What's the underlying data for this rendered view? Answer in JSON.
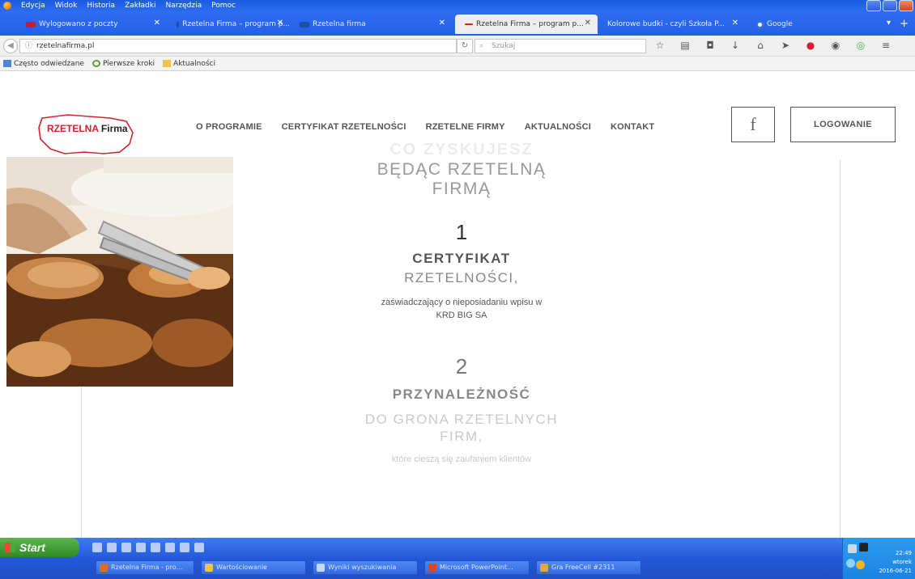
{
  "browser": {
    "menu": [
      "Edycja",
      "Widok",
      "Historia",
      "Zakładki",
      "Narzędzia",
      "Pomoc"
    ],
    "tabs": [
      {
        "label": "Wylogowano z poczty"
      },
      {
        "label": "Rzetelna Firma – program p..."
      },
      {
        "label": "Rzetelna firma"
      },
      {
        "label": "Rzetelna Firma – program p..."
      },
      {
        "label": "Kolorowe budki - czyli Szkoła P..."
      },
      {
        "label": "Google"
      }
    ],
    "url": "rzetelnafirma.pl",
    "search_placeholder": "Szukaj",
    "bookmarks": [
      "Często odwiedzane",
      "Pierwsze kroki",
      "Aktualności"
    ]
  },
  "site": {
    "logo_red": "RZETELNA",
    "logo_black": "Firma",
    "nav": [
      "O PROGRAMIE",
      "CERTYFIKAT RZETELNOŚCI",
      "RZETELNE FIRMY",
      "AKTUALNOŚCI",
      "KONTAKT"
    ],
    "fb_icon": "f",
    "login": "LOGOWANIE",
    "ghost_heading": "CO ZYSKUJESZ",
    "heading_line1": "BĘDĄC RZETELNĄ",
    "heading_line2": "FIRMĄ",
    "benefits": [
      {
        "number": "1",
        "title": "CERTYFIKAT",
        "subtitle": "RZETELNOŚCI,",
        "desc1": "zaświadczający o nieposiadaniu wpisu w",
        "desc2": "KRD BIG SA"
      },
      {
        "number": "2",
        "title": "PRZYNALEŻNOŚĆ",
        "subtitle": "DO GRONA RZETELNYCH",
        "subtitle2": "FIRM,",
        "desc1": "które cieszą się zaufaniem klientów"
      }
    ]
  },
  "taskbar": {
    "start": "Start",
    "tasks": [
      {
        "label": "Rzetelna Firma - pro..."
      },
      {
        "label": "Wartościowanie"
      },
      {
        "label": "Wyniki wyszukiwania"
      },
      {
        "label": "Microsoft PowerPoint..."
      },
      {
        "label": "Gra FreeCell #2311"
      }
    ],
    "clock_time": "22:49",
    "clock_day": "wtorek",
    "clock_date": "2016-06-21"
  },
  "colors": {
    "accent_red": "#d3232f",
    "taskbar_blue": "#2458d8",
    "start_green": "#3c9a2f"
  }
}
